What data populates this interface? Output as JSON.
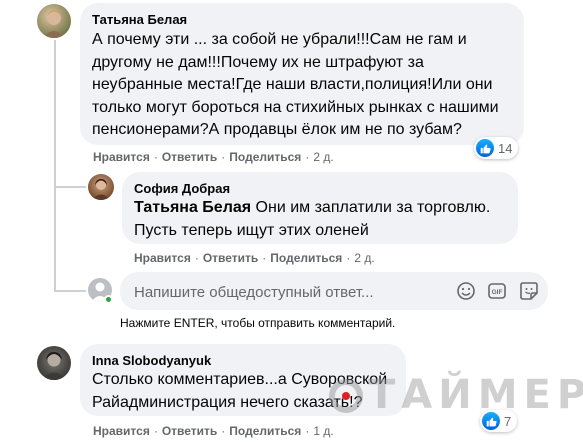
{
  "comments": [
    {
      "author": "Татьяна Белая",
      "lines": [
        "А почему эти ... за собой не убрали!!!Сам не гам и",
        "другому не дам!!!Почему их не штрафуют за",
        "неубранные места!Где наши власти,полиция!Или они",
        "только могут бороться на стихийных рынках с нашими",
        "пенсионерами?А продавцы ёлок им не по зубам?"
      ],
      "actions": {
        "like": "Нравится",
        "reply": "Ответить",
        "share": "Поделиться",
        "time": "2 д."
      },
      "reactions": {
        "icon": "like-icon",
        "count": "14"
      }
    },
    {
      "author": "София Добрая",
      "mention": "Татьяна Белая",
      "line1_rest": " Они им заплатили за торговлю.",
      "line2": "Пусть теперь ищут этих оленей",
      "actions": {
        "like": "Нравится",
        "reply": "Ответить",
        "share": "Поделиться",
        "time": "2 д."
      }
    },
    {
      "author": "Inna Slobodyanyuk",
      "lines": [
        "Столько комментариев...а Суворовской",
        "Райадминистрация нечего сказать!?"
      ],
      "actions": {
        "like": "Нравится",
        "reply": "Ответить",
        "share": "Поделиться",
        "time": "1 д."
      },
      "reactions": {
        "icon": "like-icon",
        "count": "7"
      }
    }
  ],
  "reply_box": {
    "placeholder": "Напишите общедоступный ответ...",
    "icons": [
      "emoji-icon",
      "gif-icon",
      "sticker-icon"
    ],
    "hint": "Нажмите ENTER, чтобы отправить комментарий."
  },
  "watermark": "ТАЙМЕР",
  "colors": {
    "bubble": "#f0f2f5",
    "secondary_text": "#65676b",
    "like_blue": "#1877f2"
  }
}
